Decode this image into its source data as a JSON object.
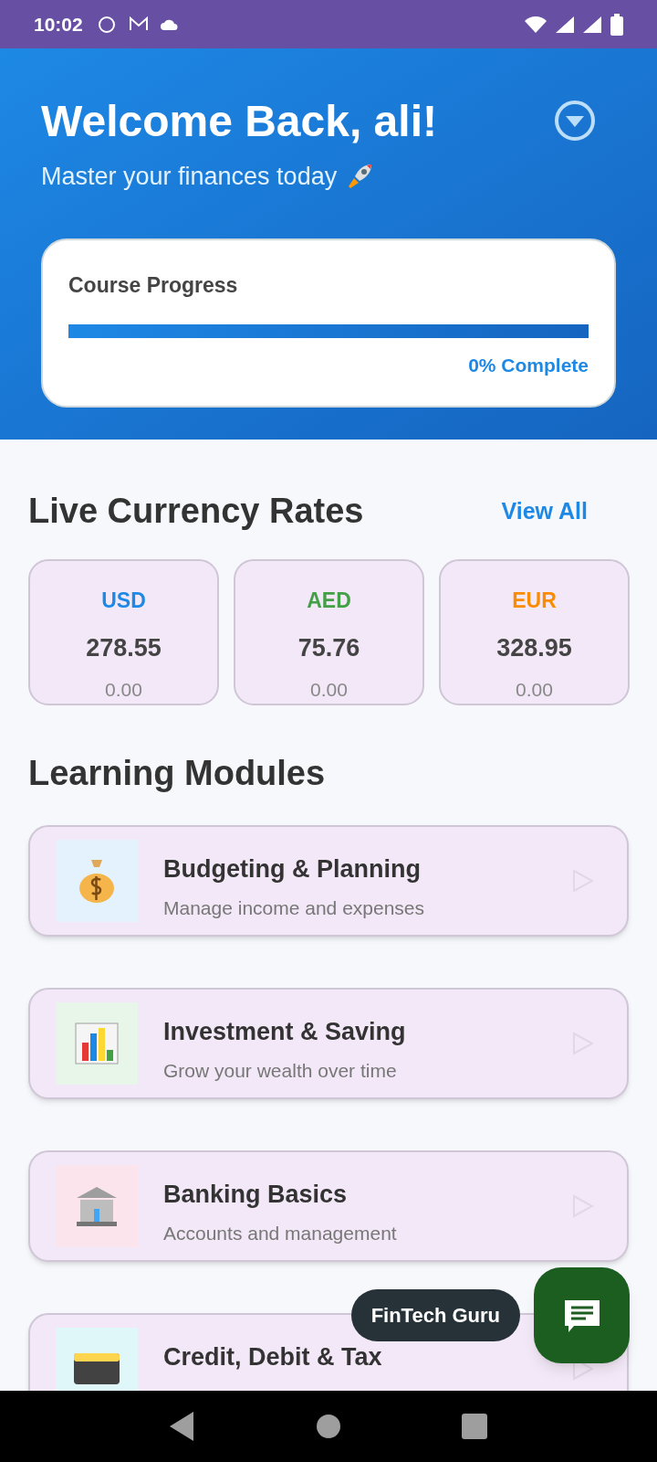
{
  "status_bar": {
    "time": "10:02"
  },
  "header": {
    "title": "Welcome Back, ali!",
    "subtitle": "Master your finances today"
  },
  "progress": {
    "title": "Course Progress",
    "level": 0,
    "reading": "0% Complete"
  },
  "currency": {
    "title": "Live Currency Rates",
    "link": "View All",
    "rates": [
      {
        "code": "USD",
        "color": "#1e88e5",
        "value": "278.55",
        "change": "0.00"
      },
      {
        "code": "AED",
        "color": "#43a047",
        "value": "75.76",
        "change": "0.00"
      },
      {
        "code": "EUR",
        "color": "#fb8c00",
        "value": "328.95",
        "change": "0.00"
      }
    ]
  },
  "modules": {
    "title": "Learning Modules",
    "items": [
      {
        "kind": "bag",
        "title": "Budgeting & Planning",
        "subtitle": "Manage income and expenses"
      },
      {
        "kind": "chart",
        "title": "Investment & Saving",
        "subtitle": "Grow your wealth over time"
      },
      {
        "kind": "bank",
        "title": "Banking Basics",
        "subtitle": "Accounts and management"
      },
      {
        "kind": "card",
        "title": "Credit, Debit & Tax"
      }
    ]
  },
  "assistant": {
    "label": "FinTech Guru"
  }
}
